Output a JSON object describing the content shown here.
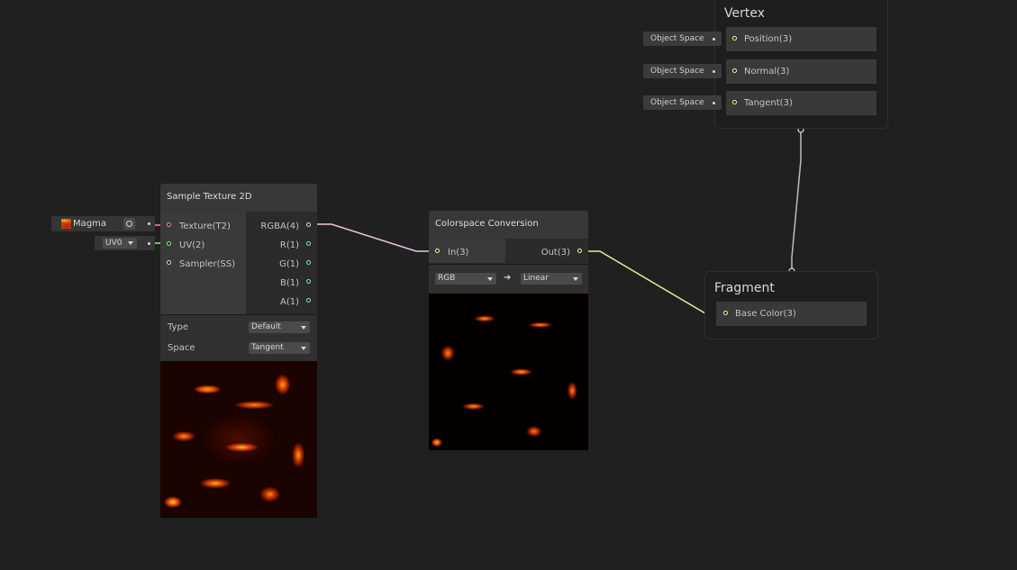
{
  "vertex": {
    "title": "Vertex",
    "ports": [
      {
        "label": "Position(3)",
        "space": "Object Space"
      },
      {
        "label": "Normal(3)",
        "space": "Object Space"
      },
      {
        "label": "Tangent(3)",
        "space": "Object Space"
      }
    ]
  },
  "fragment": {
    "title": "Fragment",
    "ports": [
      {
        "label": "Base Color(3)"
      }
    ]
  },
  "sample_texture": {
    "title": "Sample Texture 2D",
    "inputs": [
      {
        "label": "Texture(T2)"
      },
      {
        "label": "UV(2)"
      },
      {
        "label": "Sampler(SS)"
      }
    ],
    "outputs": [
      {
        "label": "RGBA(4)"
      },
      {
        "label": "R(1)"
      },
      {
        "label": "G(1)"
      },
      {
        "label": "B(1)"
      },
      {
        "label": "A(1)"
      }
    ],
    "settings": [
      {
        "label": "Type",
        "value": "Default"
      },
      {
        "label": "Space",
        "value": "Tangent"
      }
    ],
    "texture_input": "Magma",
    "uv_input": "UV0"
  },
  "colorspace": {
    "title": "Colorspace Conversion",
    "input": "In(3)",
    "output": "Out(3)",
    "from": "RGB",
    "arrow": "➔",
    "to": "Linear"
  },
  "colors": {
    "background": "#202020",
    "port_vector3": "#f6ff9a",
    "port_vector4": "#fbcbf4",
    "port_texture": "#ff8b8b",
    "port_vector2": "#9aef92",
    "port_float": "#84e4e7",
    "port_sampler": "#dcdcdc",
    "wire_rgba": "#e8c8e4",
    "wire_vector3": "#e5ef90",
    "wire_flow": "#bdbdbd"
  }
}
